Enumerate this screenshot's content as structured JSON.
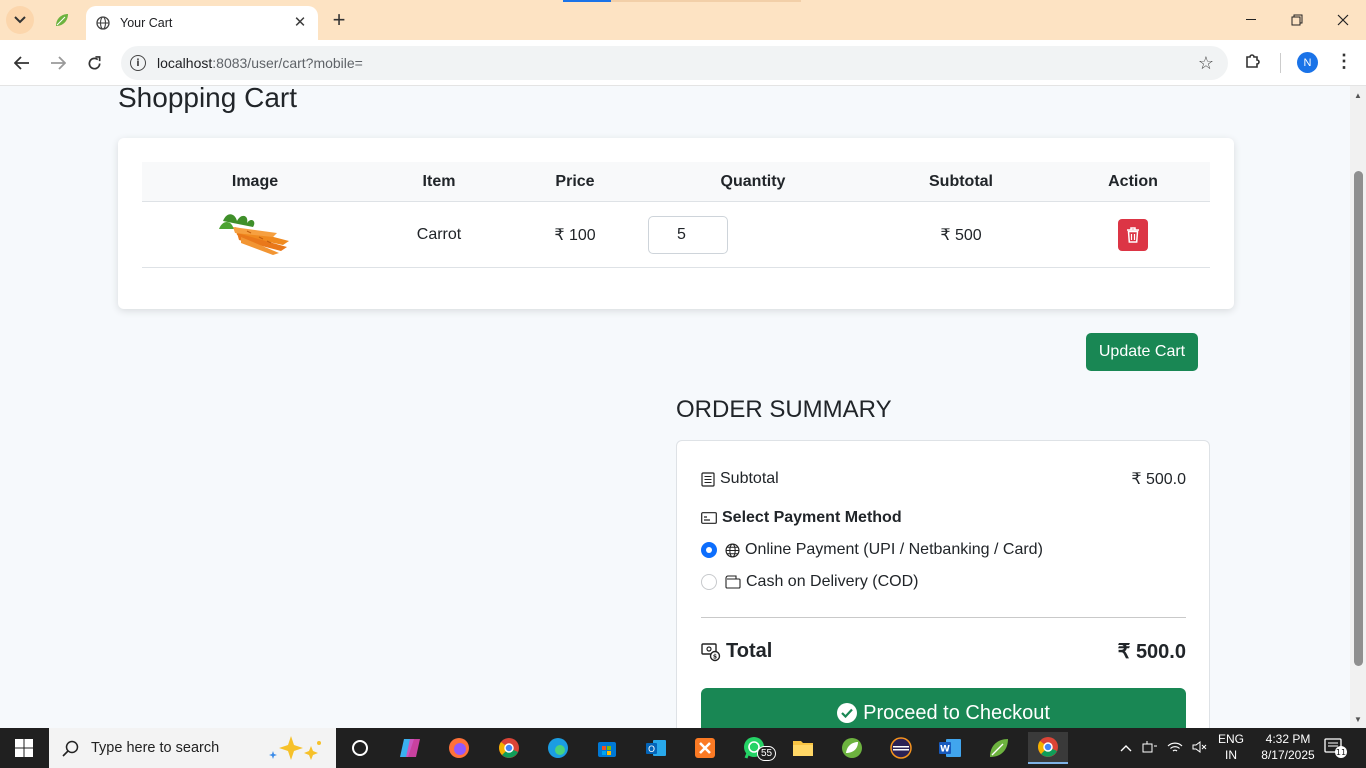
{
  "browser": {
    "tab_title": "Your Cart",
    "url_host": "localhost",
    "url_path": ":8083/user/cart?mobile=",
    "profile_initial": "N"
  },
  "page": {
    "title": "Shopping Cart",
    "table": {
      "headers": [
        "Image",
        "Item",
        "Price",
        "Quantity",
        "Subtotal",
        "Action"
      ],
      "rows": [
        {
          "item": "Carrot",
          "price": "₹ 100",
          "quantity": "5",
          "subtotal": "₹ 500"
        }
      ]
    },
    "update_cart_label": "Update Cart",
    "summary": {
      "title": "ORDER SUMMARY",
      "subtotal_label": "Subtotal",
      "subtotal_value": "₹ 500.0",
      "payment_title": "Select Payment Method",
      "payment_options": [
        {
          "label": "Online Payment (UPI / Netbanking / Card)",
          "selected": true
        },
        {
          "label": "Cash on Delivery (COD)",
          "selected": false
        }
      ],
      "total_label": "Total",
      "total_value": "₹ 500.0",
      "checkout_label": "Proceed to Checkout"
    }
  },
  "taskbar": {
    "search_placeholder": "Type here to search",
    "whatsapp_badge": "55",
    "lang_line1": "ENG",
    "lang_line2": "IN",
    "time": "4:32 PM",
    "date": "8/17/2025",
    "notification_count": "11"
  },
  "colors": {
    "accent_green": "#198754",
    "delete_red": "#dc3545",
    "radio_blue": "#0d6efd",
    "tabbar_bg": "#fde3c3"
  }
}
